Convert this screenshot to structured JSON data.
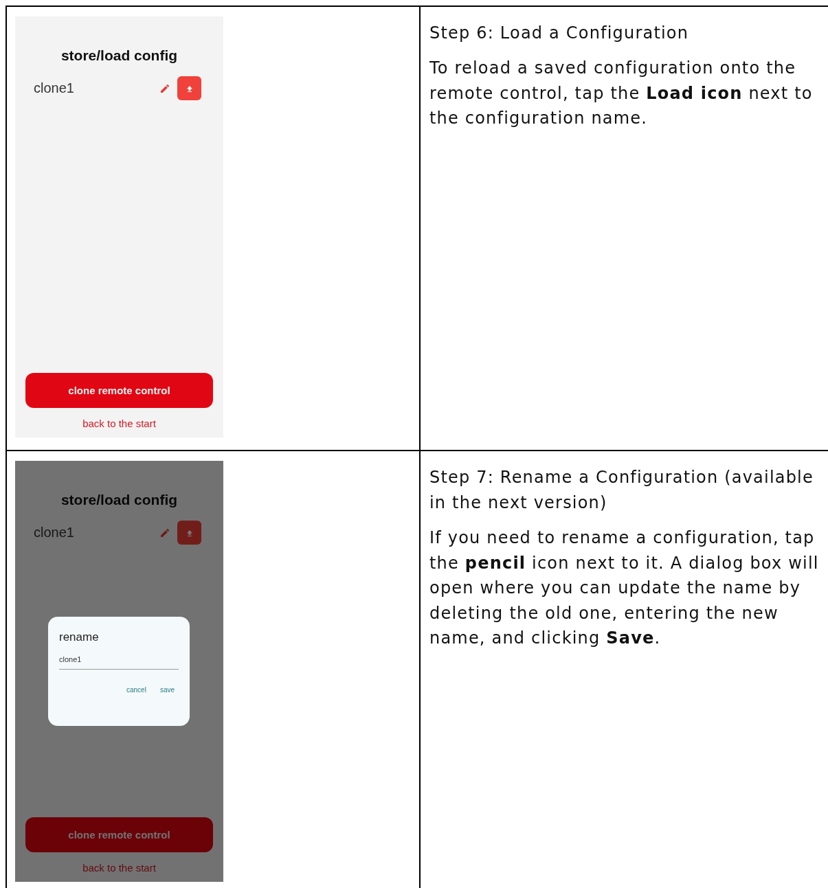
{
  "steps": [
    {
      "screen": {
        "title": "store/load config",
        "configs": [
          {
            "name": "clone1"
          }
        ],
        "dimmed": false,
        "primary_button": "clone remote control",
        "link": "back to the start"
      },
      "heading": "Step 6: Load a Configuration",
      "body": "To reload a saved configuration onto the remote control, tap the **Load icon** next to the configuration name."
    },
    {
      "screen": {
        "title": "store/load config",
        "configs": [
          {
            "name": "clone1"
          }
        ],
        "dimmed": true,
        "dialog": {
          "title": "rename",
          "value": "clone1",
          "buttons": [
            "cancel",
            "save"
          ]
        },
        "primary_button": "clone remote control",
        "link": "back to the start"
      },
      "heading": "Step 7: Rename a Configuration (available in the next version)",
      "body": "If you need to rename a configuration, tap the **pencil** icon next to it. A dialog box will open where you can update the name by deleting the old one, entering the new name, and clicking **Save**."
    }
  ]
}
